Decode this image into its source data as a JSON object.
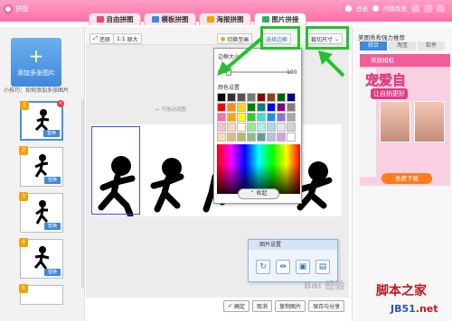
{
  "window": {
    "title": "拼图",
    "user": "登录",
    "feedback": "问题反馈"
  },
  "tabs": [
    {
      "label": "自由拼图",
      "icon_color": "#e8477f"
    },
    {
      "label": "模板拼图",
      "icon_color": "#3f88db"
    },
    {
      "label": "海报拼图",
      "icon_color": "#f3a20b"
    },
    {
      "label": "图片拼接",
      "icon_color": "#2fae5c"
    }
  ],
  "toolbar": {
    "restore": "还原",
    "original_size": "原大",
    "switch_bg": "切换至画",
    "border_select": "选择边框",
    "cut_size": "裁切尺寸"
  },
  "left_panel": {
    "add_label": "添加多张图片",
    "tip": "小技巧：如何添加多张图片",
    "thumbs": [
      {
        "num": "1",
        "replace": "替换"
      },
      {
        "num": "2",
        "replace": "替换"
      },
      {
        "num": "3",
        "replace": "替换"
      },
      {
        "num": "4",
        "replace": "替换"
      },
      {
        "num": "5",
        "replace": ""
      }
    ]
  },
  "canvas": {
    "faint_text": "← 可拖动调整"
  },
  "border_popup": {
    "size_label": "边框大小",
    "min": "0",
    "max": "100",
    "value": 0.08,
    "color_label": "颜色设置",
    "collapse": "收起",
    "colors": [
      "#000000",
      "#333333",
      "#555555",
      "#777777",
      "#8b0000",
      "#8b4513",
      "#006400",
      "#00008b",
      "#ff0000",
      "#ff8c00",
      "#ffd700",
      "#008000",
      "#008080",
      "#0000ff",
      "#800080",
      "#808080",
      "#ff69b4",
      "#ffa500",
      "#ffff00",
      "#32cd32",
      "#40e0d0",
      "#1e90ff",
      "#9370db",
      "#a9a9a9",
      "#ffc0cb",
      "#ffdab9",
      "#ffffe0",
      "#90ee90",
      "#afeeee",
      "#add8e6",
      "#e6e6fa",
      "#d3d3d3",
      "#f5deb3",
      "#deb887",
      "#bdb76b",
      "#8fbc8f",
      "#5f9ea0",
      "#b0c4de",
      "#dda0dd",
      "#ffffff"
    ]
  },
  "image_settings": {
    "title": "图片设置"
  },
  "bottom": {
    "confirm": "确定",
    "cancel": "取消",
    "copy_img": "复制图片",
    "save_share": "保存与分享"
  },
  "right_panel": {
    "title": "美图秀秀强力推荐",
    "tabs": [
      "综合",
      "淘宝",
      "软件"
    ],
    "ad_head": "美颜相机",
    "ad_big": "宠爱自",
    "ad_sub": "让自拍更好",
    "ad_foot": "免费下载"
  },
  "watermarks": {
    "baidu": "Bai 经验",
    "site": "脚本之家",
    "jb": "JB51",
    "net": ".net"
  }
}
